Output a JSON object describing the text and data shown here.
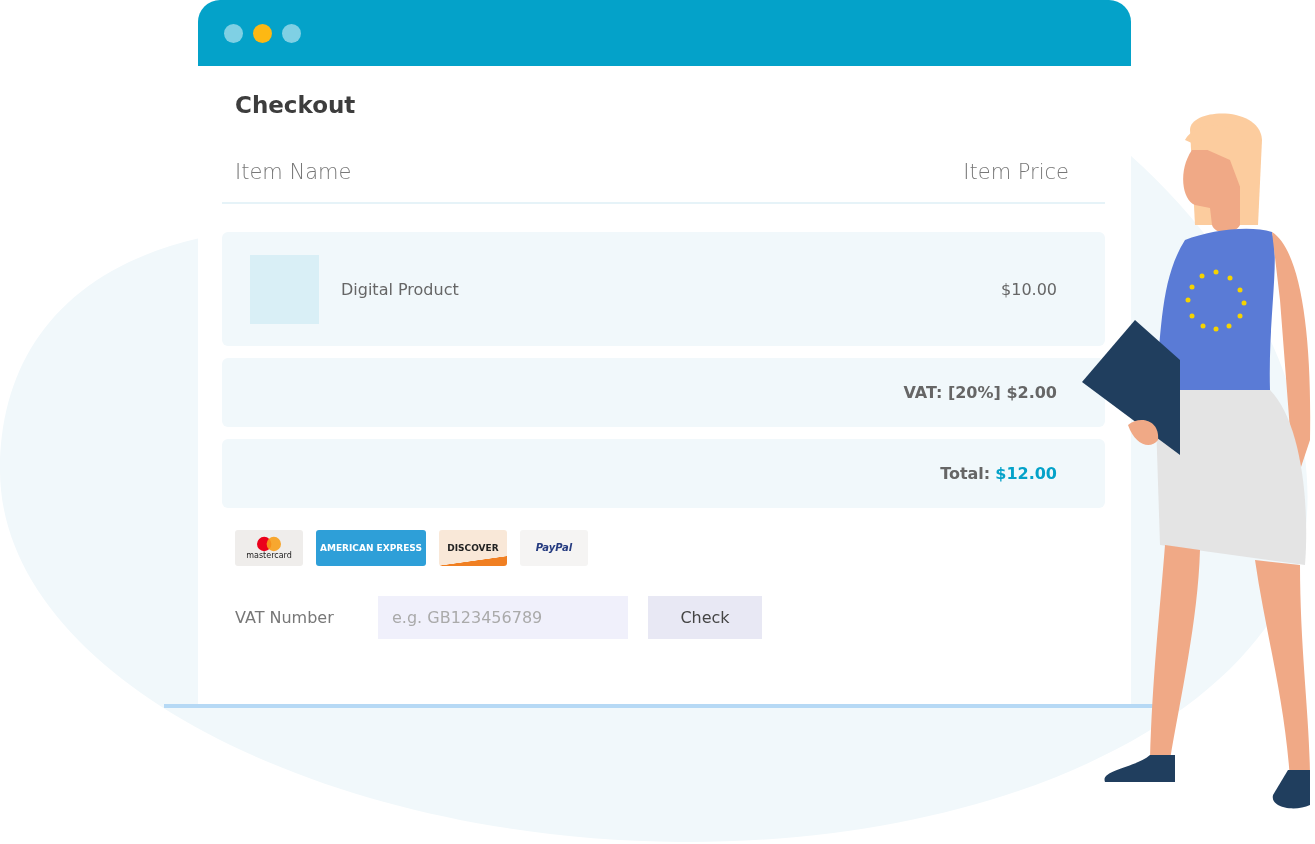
{
  "window": {
    "dots": [
      {
        "color": "#7fd0e4"
      },
      {
        "color": "#fdb813"
      },
      {
        "color": "#7fd0e4"
      }
    ]
  },
  "checkout": {
    "title": "Checkout",
    "columns": [
      "Item Name",
      "Item Price"
    ],
    "items": [
      {
        "name": "Digital Product",
        "price": "$10.00"
      }
    ],
    "vat": {
      "label": "VAT: [20%] $2.00"
    },
    "total": {
      "label": "Total:",
      "amount": "$12.00"
    },
    "cards": [
      {
        "kind": "mastercard",
        "text": "mastercard"
      },
      {
        "kind": "amex",
        "text": "AMERICAN EXPRESS"
      },
      {
        "kind": "discover",
        "text": "DISCOVER"
      },
      {
        "kind": "paypal",
        "text": "PayPal"
      }
    ],
    "vat_number": {
      "label": "VAT Number",
      "placeholder": "e.g. GB123456789",
      "button": "Check"
    }
  }
}
